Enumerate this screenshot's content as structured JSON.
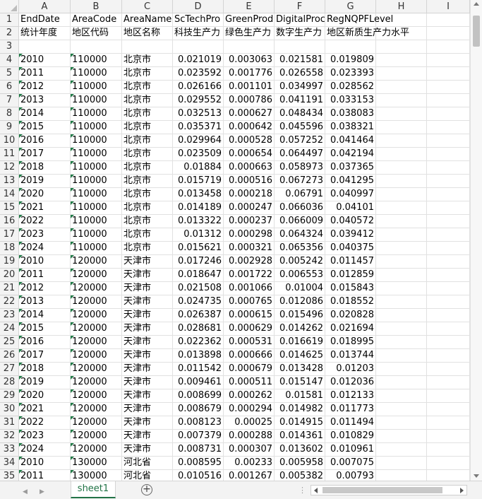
{
  "columns": [
    "A",
    "B",
    "C",
    "D",
    "E",
    "F",
    "G",
    "H",
    "I"
  ],
  "header_row": [
    "EndDate",
    "AreaCode",
    "AreaName",
    "ScTechPro",
    "GreenProd",
    "DigitalProc",
    "RegNQPFLevel",
    "",
    ""
  ],
  "label_row": [
    "统计年度",
    "地区代码",
    "地区名称",
    "科技生产力",
    "绿色生产力",
    "数字生产力",
    "地区新质生产力水平",
    "",
    ""
  ],
  "rows": [
    [
      "2010",
      "110000",
      "北京市",
      "0.021019",
      "0.003063",
      "0.021581",
      "0.019809"
    ],
    [
      "2011",
      "110000",
      "北京市",
      "0.023592",
      "0.001776",
      "0.026558",
      "0.023393"
    ],
    [
      "2012",
      "110000",
      "北京市",
      "0.026166",
      "0.001101",
      "0.034997",
      "0.028562"
    ],
    [
      "2013",
      "110000",
      "北京市",
      "0.029552",
      "0.000786",
      "0.041191",
      "0.033153"
    ],
    [
      "2014",
      "110000",
      "北京市",
      "0.032513",
      "0.000627",
      "0.048434",
      "0.038083"
    ],
    [
      "2015",
      "110000",
      "北京市",
      "0.035371",
      "0.000642",
      "0.045596",
      "0.038321"
    ],
    [
      "2016",
      "110000",
      "北京市",
      "0.029964",
      "0.000528",
      "0.057252",
      "0.041464"
    ],
    [
      "2017",
      "110000",
      "北京市",
      "0.023509",
      "0.000654",
      "0.064497",
      "0.042194"
    ],
    [
      "2018",
      "110000",
      "北京市",
      "0.01884",
      "0.000663",
      "0.058973",
      "0.037365"
    ],
    [
      "2019",
      "110000",
      "北京市",
      "0.015719",
      "0.000516",
      "0.067273",
      "0.041295"
    ],
    [
      "2020",
      "110000",
      "北京市",
      "0.013458",
      "0.000218",
      "0.06791",
      "0.040997"
    ],
    [
      "2021",
      "110000",
      "北京市",
      "0.014189",
      "0.000247",
      "0.066036",
      "0.04101"
    ],
    [
      "2022",
      "110000",
      "北京市",
      "0.013322",
      "0.000237",
      "0.066009",
      "0.040572"
    ],
    [
      "2023",
      "110000",
      "北京市",
      "0.01312",
      "0.000298",
      "0.064324",
      "0.039412"
    ],
    [
      "2024",
      "110000",
      "北京市",
      "0.015621",
      "0.000321",
      "0.065356",
      "0.040375"
    ],
    [
      "2010",
      "120000",
      "天津市",
      "0.017246",
      "0.002928",
      "0.005242",
      "0.011457"
    ],
    [
      "2011",
      "120000",
      "天津市",
      "0.018647",
      "0.001722",
      "0.006553",
      "0.012859"
    ],
    [
      "2012",
      "120000",
      "天津市",
      "0.021508",
      "0.001066",
      "0.01004",
      "0.015843"
    ],
    [
      "2013",
      "120000",
      "天津市",
      "0.024735",
      "0.000765",
      "0.012086",
      "0.018552"
    ],
    [
      "2014",
      "120000",
      "天津市",
      "0.026387",
      "0.000615",
      "0.015496",
      "0.020828"
    ],
    [
      "2015",
      "120000",
      "天津市",
      "0.028681",
      "0.000629",
      "0.014262",
      "0.021694"
    ],
    [
      "2016",
      "120000",
      "天津市",
      "0.022362",
      "0.000531",
      "0.016619",
      "0.018995"
    ],
    [
      "2017",
      "120000",
      "天津市",
      "0.013898",
      "0.000666",
      "0.014625",
      "0.013744"
    ],
    [
      "2018",
      "120000",
      "天津市",
      "0.011542",
      "0.000679",
      "0.013428",
      "0.01203"
    ],
    [
      "2019",
      "120000",
      "天津市",
      "0.009461",
      "0.000511",
      "0.015147",
      "0.012036"
    ],
    [
      "2020",
      "120000",
      "天津市",
      "0.008699",
      "0.000262",
      "0.01581",
      "0.012133"
    ],
    [
      "2021",
      "120000",
      "天津市",
      "0.008679",
      "0.000294",
      "0.014982",
      "0.011773"
    ],
    [
      "2022",
      "120000",
      "天津市",
      "0.008123",
      "0.00025",
      "0.014915",
      "0.011494"
    ],
    [
      "2023",
      "120000",
      "天津市",
      "0.007379",
      "0.000288",
      "0.014361",
      "0.010829"
    ],
    [
      "2024",
      "120000",
      "天津市",
      "0.008731",
      "0.000307",
      "0.013602",
      "0.010961"
    ],
    [
      "2010",
      "130000",
      "河北省",
      "0.008595",
      "0.00233",
      "0.005958",
      "0.007075"
    ],
    [
      "2011",
      "130000",
      "河北省",
      "0.010516",
      "0.001267",
      "0.005382",
      "0.00793"
    ]
  ],
  "sheet_tab": "sheet1",
  "colors": {
    "accent": "#217346",
    "grid": "#e1e1e1",
    "header_bg": "#f3f3f3"
  },
  "icons": {
    "add_sheet": "plus-circle-icon",
    "prev": "triangle-left-icon",
    "next": "triangle-right-icon"
  }
}
